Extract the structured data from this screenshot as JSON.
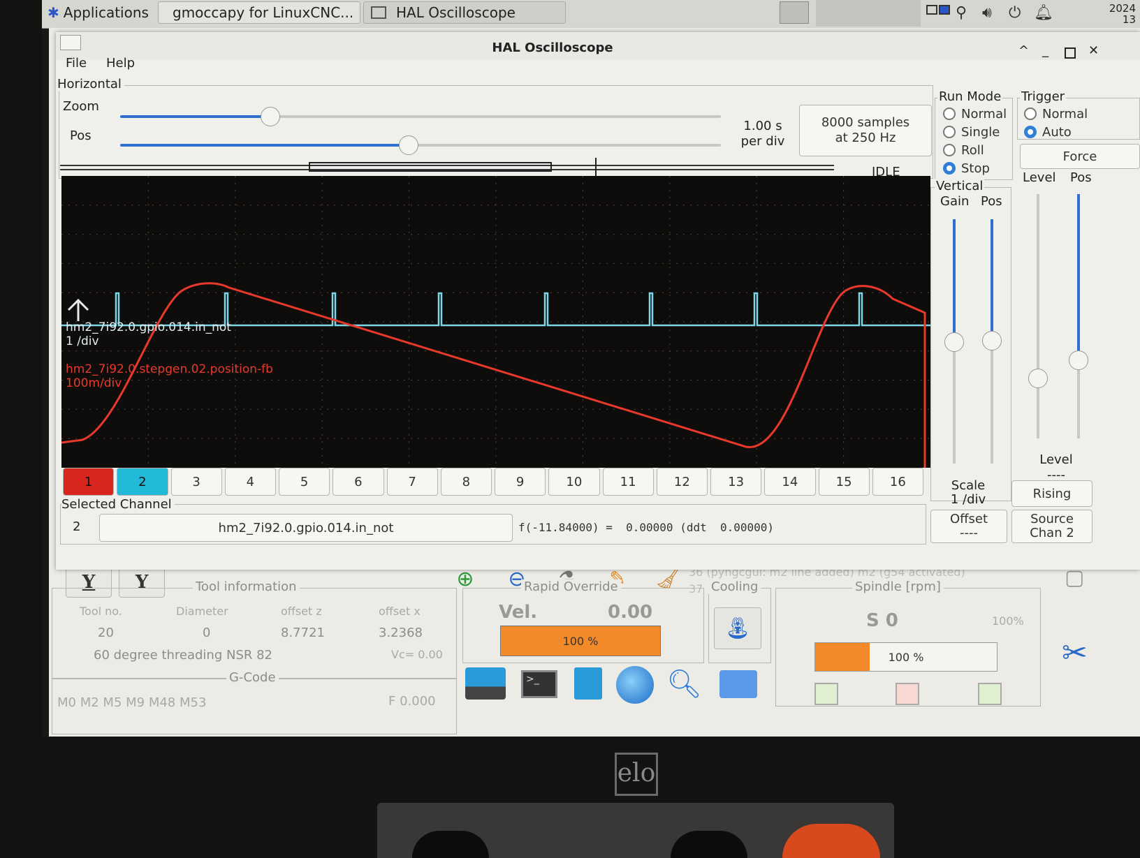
{
  "taskbar": {
    "applications": "Applications",
    "task1": "gmoccapy for LinuxCNC...",
    "task2": "HAL Oscilloscope",
    "clock_date": "2024",
    "clock_time": "13"
  },
  "window": {
    "title": "HAL Oscilloscope",
    "menu": [
      "File",
      "Help"
    ]
  },
  "horizontal": {
    "label": "Horizontal",
    "zoom_label": "Zoom",
    "pos_label": "Pos",
    "zoom_value": 0.25,
    "pos_value": 0.48,
    "per_div_value": "1.00 s",
    "per_div_unit": "per div",
    "samples": "8000 samples",
    "rate": "at 250 Hz",
    "state": "IDLE"
  },
  "run_mode": {
    "label": "Run Mode",
    "options": [
      "Normal",
      "Single",
      "Roll",
      "Stop"
    ],
    "selected": "Stop"
  },
  "trigger": {
    "label": "Trigger",
    "options": [
      "Normal",
      "Auto"
    ],
    "selected": "Auto",
    "force": "Force",
    "level_col": "Level",
    "pos_col": "Pos",
    "level_label": "Level",
    "level_value": "----",
    "edge": "Rising",
    "source_label": "Source",
    "source_value": "Chan 2"
  },
  "vertical": {
    "label": "Vertical",
    "gain": "Gain",
    "pos": "Pos",
    "scale_label": "Scale",
    "scale_value": "1 /div",
    "offset_label": "Offset",
    "offset_value": "----"
  },
  "traces": {
    "ch2_name": "hm2_7i92.0.gpio.014.in_not",
    "ch2_scale": "1 /div",
    "ch1_name": "hm2_7i92.0.stepgen.02.position-fb",
    "ch1_scale": "100m/div",
    "ch1_color": "#e8392c",
    "ch2_color": "#7fd6e6"
  },
  "channels": [
    "1",
    "2",
    "3",
    "4",
    "5",
    "6",
    "7",
    "8",
    "9",
    "10",
    "11",
    "12",
    "13",
    "14",
    "15",
    "16"
  ],
  "channel_colors": {
    "1": "#d8261e",
    "2": "#22b8d8"
  },
  "selected_channel": {
    "label": "Selected Channel",
    "number": "2",
    "name": "hm2_7i92.0.gpio.014.in_not",
    "readout": "f(-11.84000) =  0.00000 (ddt  0.00000)"
  },
  "gmoccapy": {
    "toolbar_y1": "Y",
    "toolbar_y2": "Y",
    "messages": [
      "36    (pyngcgui: m2 line added) m2 (g54 activated)",
      "37"
    ],
    "tool_info": {
      "title": "Tool information",
      "headers": [
        "Tool no.",
        "Diameter",
        "offset z",
        "offset x"
      ],
      "values": [
        "20",
        "0",
        "8.7721",
        "3.2368"
      ],
      "description": "60 degree threading NSR 82",
      "vc": "Vc= 0.00"
    },
    "gcode": {
      "title": "G-Code",
      "codes": "M0 M2 M5 M9 M48 M53",
      "feed": "F   0.000"
    },
    "rapid": {
      "title": "Rapid Override",
      "vel_label": "Vel.",
      "vel_value": "0.00",
      "percent": "100 %"
    },
    "cooling": {
      "title": "Cooling"
    },
    "spindle": {
      "title": "Spindle [rpm]",
      "value": "S  0",
      "percent_small": "100%",
      "percent": "100 %",
      "fill": 0.3
    }
  },
  "bezel": {
    "brand": "elo"
  }
}
